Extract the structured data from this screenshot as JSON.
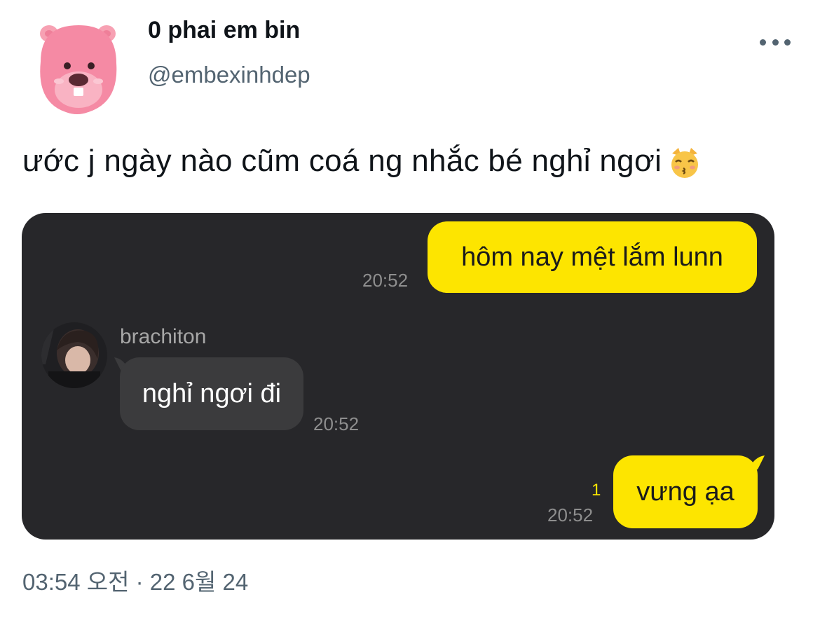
{
  "tweet": {
    "display_name": "0 phai em bin",
    "handle": "@embexinhdep",
    "text": "ước j ngày nào cũm coá ng nhắc bé nghỉ ngơi",
    "emoji_icon": "kissing-cat-face-icon",
    "timestamp": "03:54 오전 · 22 6월 24"
  },
  "chat": {
    "messages": [
      {
        "sender": "me",
        "text": "hôm nay mệt lắm lunn",
        "time": "20:52"
      },
      {
        "sender": "brachiton",
        "text": "nghỉ ngơi đi",
        "time": "20:52"
      },
      {
        "sender": "me",
        "text": "vưng ạa",
        "time": "20:52",
        "unread": "1"
      }
    ]
  },
  "colors": {
    "chat_bg": "#27272a",
    "my_bubble": "#fde500",
    "their_bubble": "#3b3b3d",
    "secondary_text": "#536471"
  }
}
